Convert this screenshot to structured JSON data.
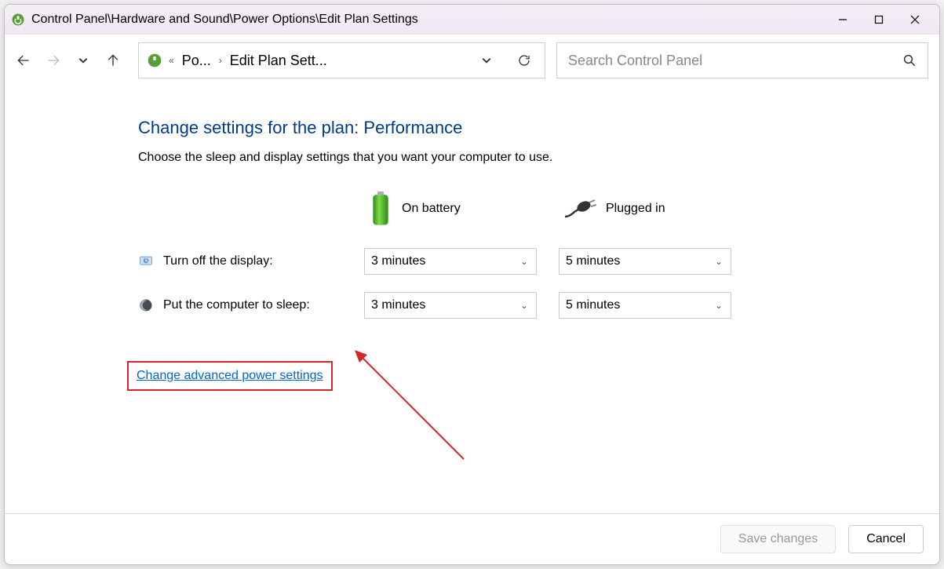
{
  "window": {
    "title": "Control Panel\\Hardware and Sound\\Power Options\\Edit Plan Settings"
  },
  "breadcrumb": {
    "item1": "Po...",
    "item2": "Edit Plan Sett..."
  },
  "search": {
    "placeholder": "Search Control Panel"
  },
  "main": {
    "heading": "Change settings for the plan: Performance",
    "subtext": "Choose the sleep and display settings that you want your computer to use.",
    "headers": {
      "battery": "On battery",
      "plugged": "Plugged in"
    },
    "rows": {
      "display": {
        "label": "Turn off the display:",
        "battery": "3 minutes",
        "plugged": "5 minutes"
      },
      "sleep": {
        "label": "Put the computer to sleep:",
        "battery": "3 minutes",
        "plugged": "5 minutes"
      }
    },
    "advanced_link": "Change advanced power settings"
  },
  "footer": {
    "save": "Save changes",
    "cancel": "Cancel"
  }
}
